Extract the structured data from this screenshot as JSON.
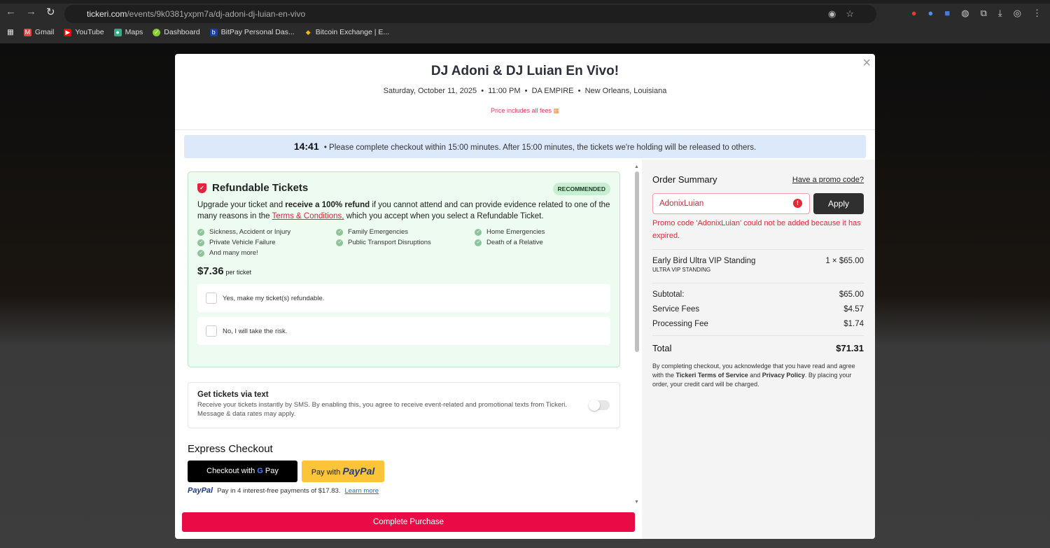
{
  "browser": {
    "url_host": "tickeri.com",
    "url_path": "/events/9k0381yxpm7a/dj-adoni-dj-luian-en-vivo",
    "bookmarks": [
      "Gmail",
      "YouTube",
      "Maps",
      "Dashboard",
      "BitPay Personal Das...",
      "Bitcoin Exchange | E..."
    ]
  },
  "event": {
    "title": "DJ Adoni & DJ Luian En Vivo!",
    "date": "Saturday, October 11, 2025",
    "time": "11:00 PM",
    "venue": "DA EMPIRE",
    "location": "New Orleans, Louisiana",
    "fees_note": "Price includes all fees"
  },
  "timer": {
    "remaining": "14:41",
    "message": "Please complete checkout within 15:00 minutes. After 15:00 minutes, the tickets we're holding will be released to others."
  },
  "refund": {
    "title": "Refundable Tickets",
    "badge": "RECOMMENDED",
    "desc_pre": "Upgrade your ticket and ",
    "desc_bold": "receive a 100% refund",
    "desc_mid": " if you cannot attend and can provide evidence related to one of the many reasons in the ",
    "terms_link": "Terms & Conditions,",
    "desc_post": " which you accept when you select a Refundable Ticket.",
    "reasons": [
      "Sickness, Accident or Injury",
      "Family Emergencies",
      "Home Emergencies",
      "Private Vehicle Failure",
      "Public Transport Disruptions",
      "Death of a Relative",
      "And many more!"
    ],
    "price": "$7.36",
    "price_unit": "per ticket",
    "option_yes": "Yes, make my ticket(s) refundable.",
    "option_no": "No, I will take the risk."
  },
  "sms": {
    "title": "Get tickets via text",
    "desc": "Receive your tickets instantly by SMS. By enabling this, you agree to receive event-related and promotional texts from Tickeri. Message & data rates may apply.",
    "enabled": false
  },
  "express": {
    "title": "Express Checkout",
    "gpay_label": "Checkout with",
    "gpay_brand": "Pay",
    "paypal_label": "Pay with",
    "paypal_brand": "PayPal",
    "note_brand": "PayPal",
    "note": "Pay in 4 interest-free payments of $17.83.",
    "learn_more": "Learn more"
  },
  "cta": "Complete Purchase",
  "summary": {
    "title": "Order Summary",
    "promo_link": "Have a promo code?",
    "promo_value": "AdonixLuian",
    "apply": "Apply",
    "error": "Promo code 'AdonixLuian' could not be added because it has expired.",
    "item_name": "Early Bird Ultra VIP Standing",
    "item_type": "ULTRA VIP STANDING",
    "item_qty_price": "1 × $65.00",
    "fees": [
      {
        "label": "Subtotal:",
        "value": "$65.00"
      },
      {
        "label": "Service Fees",
        "value": "$4.57"
      },
      {
        "label": "Processing Fee",
        "value": "$1.74"
      }
    ],
    "total_label": "Total",
    "total": "$71.31",
    "legal_1": "By completing checkout, you acknowledge that you have read and agree with the ",
    "legal_tos": "Tickeri Terms of Service",
    "legal_and": " and ",
    "legal_pp": "Privacy Policy",
    "legal_2": ". By placing your order, your credit card will be charged."
  }
}
